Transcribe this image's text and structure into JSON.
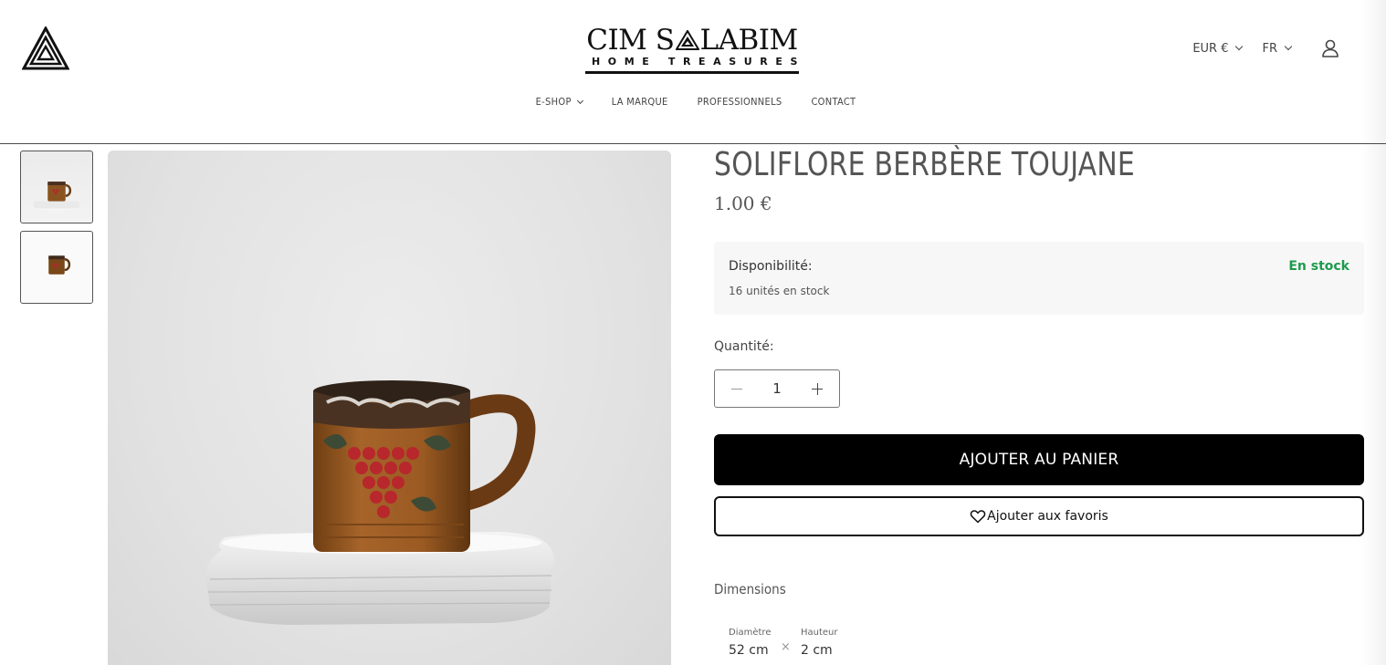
{
  "brand": {
    "name_left": "CIM S",
    "name_right": "LABIM",
    "tagline": "HOME TREASURES"
  },
  "header": {
    "currency": "EUR €",
    "language": "FR",
    "icons": [
      "triangle-logo-icon",
      "chevron-down-icon",
      "account-icon"
    ]
  },
  "nav": {
    "items": [
      {
        "label": "E-SHOP",
        "has_dropdown": true
      },
      {
        "label": "LA MARQUE"
      },
      {
        "label": "PROFESSIONNELS"
      },
      {
        "label": "CONTACT"
      }
    ]
  },
  "product": {
    "title": "SOLIFLORE BERBÈRE TOUJANE",
    "price": "1.00 €",
    "availability_label": "Disponibilité:",
    "availability_units": "16 unités en stock",
    "availability_status": "En stock",
    "status_color": "#1e9a4e",
    "quantity_label": "Quantité:",
    "quantity_value": "1",
    "add_to_cart": "AJOUTER AU PANIER",
    "add_to_favorites": "Ajouter aux favoris",
    "dimensions_title": "Dimensions",
    "dimensions": [
      {
        "label": "Diamètre",
        "value": "52 cm"
      },
      {
        "label": "Hauteur",
        "value": "2 cm"
      }
    ],
    "dimension_separator": "×"
  },
  "colors": {
    "accent": "#000000",
    "in_stock": "#1e9a4e",
    "text": "#555555"
  }
}
